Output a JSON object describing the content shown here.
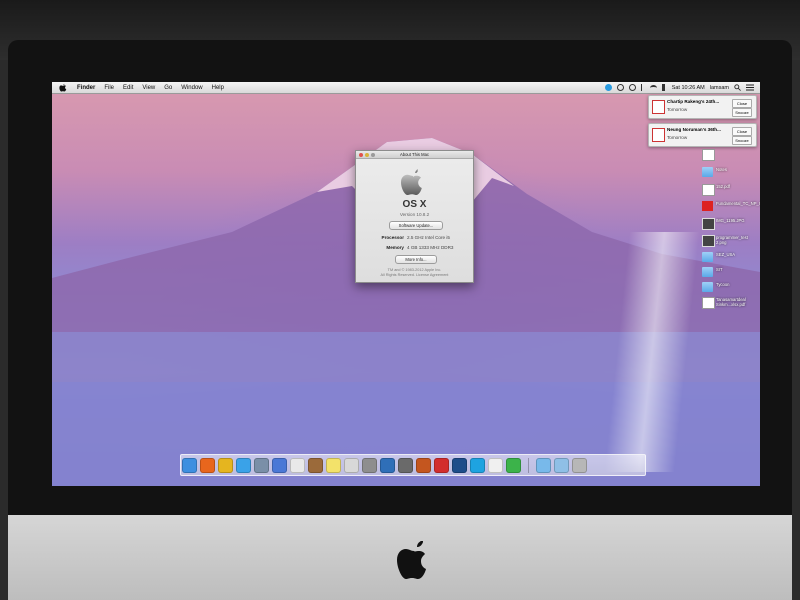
{
  "menubar": {
    "items": [
      "Finder",
      "File",
      "Edit",
      "View",
      "Go",
      "Window",
      "Help"
    ],
    "clock": "Sat 10:26 AM",
    "user": "lamsam"
  },
  "notifications": [
    {
      "title": "Chartip Rakeng's 24th...",
      "subtitle": "Tomorrow",
      "close": "Close",
      "snooze": "Snooze"
    },
    {
      "title": "Neung Noruman's 36th...",
      "subtitle": "Tomorrow",
      "close": "Close",
      "snooze": "Snooze"
    }
  ],
  "about_window": {
    "title": "About This Mac",
    "os_name": "OS X",
    "version": "Version 10.8.2",
    "software_update_button": "Software Update...",
    "processor_label": "Processor",
    "processor_value": "2.5 GHz Intel Core i5",
    "memory_label": "Memory",
    "memory_value": "4 GB 1333 MHz DDR3",
    "more_info_button": "More Info...",
    "copyright": "TM and © 1983-2012 Apple Inc.",
    "rights": "All Rights Reserved.  License Agreement"
  },
  "desktop_icons": [
    {
      "label": "",
      "kind": "doc"
    },
    {
      "label": "Notes",
      "kind": "folder"
    },
    {
      "label": "152.pdf",
      "kind": "doc"
    },
    {
      "label": "Fundamental_TC_NP_CMS...Ch.pdf",
      "kind": "pdf"
    },
    {
      "label": "IMG_1195.JPG",
      "kind": "pic"
    },
    {
      "label": "programmer_test 2.png",
      "kind": "pic"
    },
    {
      "label": "SEZ_USA",
      "kind": "folder"
    },
    {
      "label": "SIT",
      "kind": "folder"
    },
    {
      "label": "Tycoon",
      "kind": "folder"
    },
    {
      "label": "Tanasamartdeal Sinkm...xlsx.pdf",
      "kind": "doc"
    }
  ],
  "dock": {
    "apps": [
      {
        "name": "finder-icon",
        "color": "#3d8fe0"
      },
      {
        "name": "firefox-icon",
        "color": "#e8661d"
      },
      {
        "name": "chrome-icon",
        "color": "#e5b51f"
      },
      {
        "name": "safari-icon",
        "color": "#3aa2e8"
      },
      {
        "name": "mail-icon",
        "color": "#7a8fa8"
      },
      {
        "name": "itunes-icon",
        "color": "#4a78d6"
      },
      {
        "name": "calendar-icon",
        "color": "#e9e9e9"
      },
      {
        "name": "address-book-icon",
        "color": "#9b6a3a"
      },
      {
        "name": "stickies-icon",
        "color": "#f3e26a"
      },
      {
        "name": "preview-icon",
        "color": "#d8d8d8"
      },
      {
        "name": "system-preferences-icon",
        "color": "#8e8e8e"
      },
      {
        "name": "xcode-icon",
        "color": "#2f6fb8"
      },
      {
        "name": "script-editor-icon",
        "color": "#6a6a6a"
      },
      {
        "name": "ibooks-icon",
        "color": "#c4561f"
      },
      {
        "name": "filezilla-icon",
        "color": "#d22d2d"
      },
      {
        "name": "photoshop-icon",
        "color": "#1d4d8a"
      },
      {
        "name": "skype-icon",
        "color": "#1ea3e0"
      },
      {
        "name": "textedit-icon",
        "color": "#f0f0f0"
      },
      {
        "name": "line-icon",
        "color": "#3cb34a"
      },
      {
        "name": "downloads-folder-icon",
        "color": "#78b9ea"
      },
      {
        "name": "documents-folder-icon",
        "color": "#8fbfe6"
      },
      {
        "name": "trash-icon",
        "color": "#b7b7b7"
      }
    ]
  }
}
